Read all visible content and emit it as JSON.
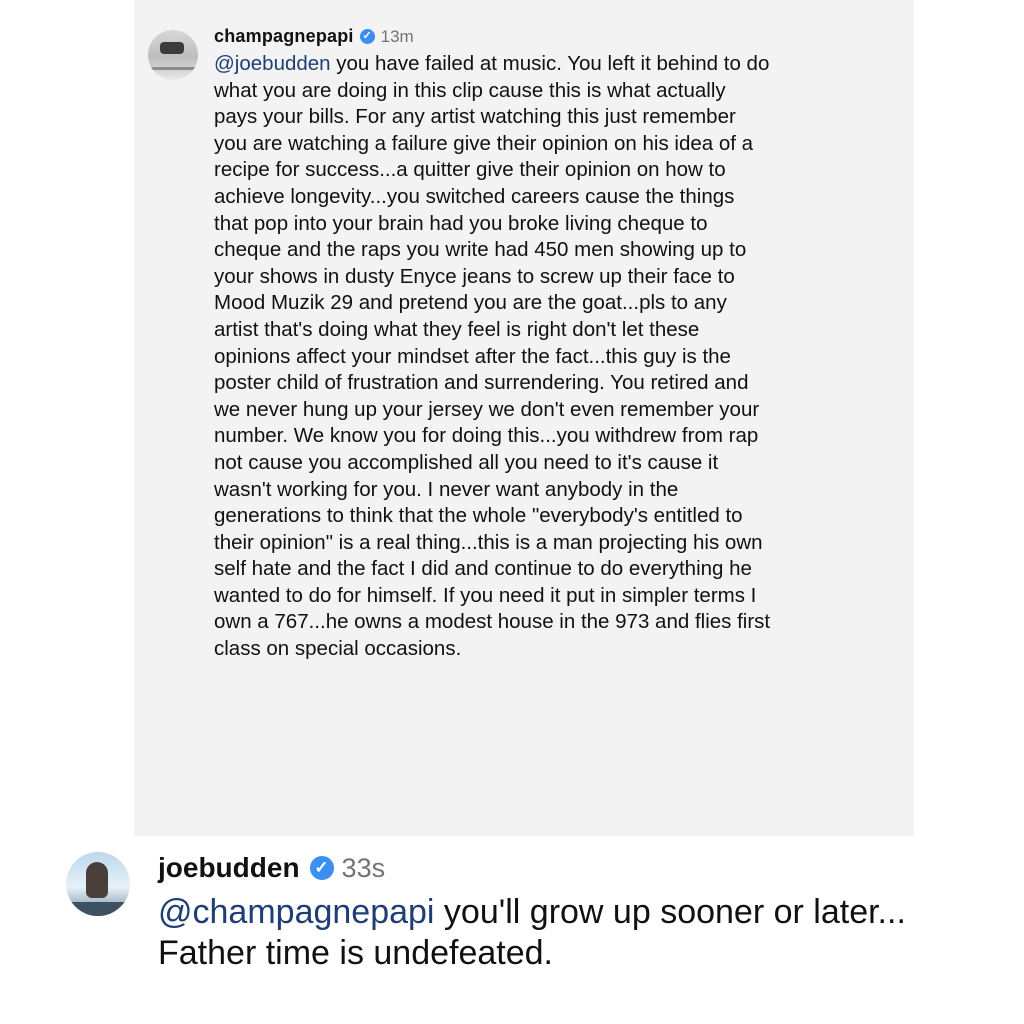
{
  "comments": [
    {
      "username": "champagnepapi",
      "time": "13m",
      "mention": "@joebudden",
      "text": " you have failed at music. You left it behind to do what you are doing in this clip cause this is what actually pays your bills. For any artist watching this just remember you are watching a failure give their opinion on his idea of a recipe for success...a quitter give their opinion on how to achieve longevity...you switched careers cause the things that pop into your brain had you broke living cheque to cheque and the raps you write had 450 men showing up to your shows in dusty Enyce jeans to screw up their face to Mood Muzik 29 and pretend you are the goat...pls to any artist that's doing what they feel is right don't let these opinions affect your mindset after the fact...this guy is the poster child of frustration and surrendering. You retired and we never hung up your jersey we don't even remember your number. We know you for doing this...you withdrew from rap not cause you accomplished all you need to it's cause it wasn't working for you. I never want anybody in the generations to think that the whole \"everybody's entitled to their opinion\" is a real thing...this is a man projecting his own self hate and the fact I did and continue to do everything he wanted to do for himself. If you need it put in simpler terms I own a 767...he owns a modest house in the 973 and flies first class on special occasions."
    },
    {
      "username": "joebudden",
      "time": "33s",
      "mention": "@champagnepapi",
      "text": " you'll grow up sooner or later... Father time is undefeated."
    }
  ],
  "icons": {
    "verified": "verified-badge-icon",
    "verified_color": "#3b8ff0"
  }
}
